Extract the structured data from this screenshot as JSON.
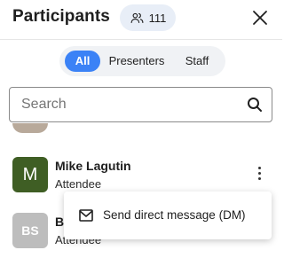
{
  "header": {
    "title": "Participants",
    "count": "111",
    "count_icon": "people-icon",
    "close_icon": "close-icon"
  },
  "filters": {
    "all": "All",
    "presenters": "Presenters",
    "staff": "Staff",
    "selected": "All",
    "accent_color": "#3b82f6"
  },
  "search": {
    "placeholder": "Search",
    "value": "",
    "icon": "search-icon"
  },
  "participants": [
    {
      "initials": "M",
      "name": "Mike Lagutin",
      "role": "Attendee",
      "avatar_color": "#3f5e24"
    },
    {
      "initials": "BS",
      "name": "B",
      "role": "Attendee",
      "avatar_color": "#bdbdbd"
    }
  ],
  "menu": {
    "items": [
      {
        "label": "Send direct message (DM)",
        "icon": "mail-icon"
      }
    ]
  }
}
